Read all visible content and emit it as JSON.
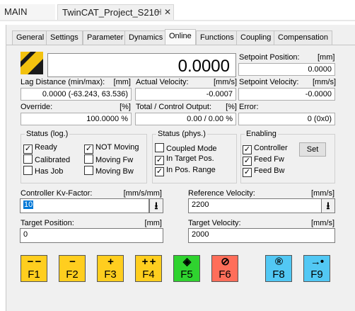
{
  "doc_tabs": {
    "main": "MAIN",
    "project": "TwinCAT_Project_S210",
    "pin": "⊣",
    "close": "✕"
  },
  "tabs": [
    "General",
    "Settings",
    "Parameter",
    "Dynamics",
    "Online",
    "Functions",
    "Coupling",
    "Compensation"
  ],
  "active_tab": "Online",
  "position": {
    "value": "0.0000"
  },
  "setpoint_position": {
    "label": "Setpoint Position:",
    "unit": "[mm]",
    "value": "0.0000"
  },
  "lag_distance": {
    "label": "Lag Distance (min/max):",
    "unit": "[mm]",
    "value": "0.0000  (-63.243, 63.536)"
  },
  "actual_velocity": {
    "label": "Actual Velocity:",
    "unit": "[mm/s]",
    "value": "-0.0007"
  },
  "setpoint_velocity": {
    "label": "Setpoint Velocity:",
    "unit": "[mm/s]",
    "value": "-0.0000"
  },
  "override": {
    "label": "Override:",
    "unit": "[%]",
    "value": "100.0000 %"
  },
  "control_output": {
    "label": "Total / Control Output:",
    "unit": "[%]",
    "value": "0.00 /  0.00 %"
  },
  "error": {
    "label": "Error:",
    "value": "0 (0x0)"
  },
  "status_log": {
    "title": "Status (log.)",
    "items": [
      {
        "label": "Ready",
        "checked": true
      },
      {
        "label": "Calibrated",
        "checked": false
      },
      {
        "label": "Has Job",
        "checked": false
      },
      {
        "label": "NOT Moving",
        "checked": true
      },
      {
        "label": "Moving Fw",
        "checked": false
      },
      {
        "label": "Moving Bw",
        "checked": false
      }
    ]
  },
  "status_phys": {
    "title": "Status (phys.)",
    "items": [
      {
        "label": "Coupled Mode",
        "checked": false
      },
      {
        "label": "In Target Pos.",
        "checked": true
      },
      {
        "label": "In Pos. Range",
        "checked": true
      }
    ]
  },
  "enabling": {
    "title": "Enabling",
    "items": [
      {
        "label": "Controller",
        "checked": true
      },
      {
        "label": "Feed Fw",
        "checked": true
      },
      {
        "label": "Feed Bw",
        "checked": true
      }
    ],
    "set_label": "Set"
  },
  "kv_factor": {
    "label": "Controller Kv-Factor:",
    "unit": "[mm/s/mm]",
    "value": "10"
  },
  "reference_velocity": {
    "label": "Reference Velocity:",
    "unit": "[mm/s]",
    "value": "2200"
  },
  "target_position": {
    "label": "Target Position:",
    "unit": "[mm]",
    "value": "0"
  },
  "target_velocity": {
    "label": "Target Velocity:",
    "unit": "[mm/s]",
    "value": "2000"
  },
  "spin_symbol": "⭳",
  "fkeys": [
    {
      "key": "F1",
      "symbol": "− −",
      "color": "#ffce1f"
    },
    {
      "key": "F2",
      "symbol": "−",
      "color": "#ffce1f"
    },
    {
      "key": "F3",
      "symbol": "+",
      "color": "#ffce1f"
    },
    {
      "key": "F4",
      "symbol": "+ +",
      "color": "#ffce1f"
    },
    {
      "key": "F5",
      "symbol": "◈",
      "color": "#2fd32f"
    },
    {
      "key": "F6",
      "symbol": "⊘",
      "color": "#ff6e5a"
    },
    {
      "key": "F8",
      "symbol": "®",
      "color": "#52c8f4"
    },
    {
      "key": "F9",
      "symbol": "→•",
      "color": "#52c8f4"
    }
  ],
  "colors": {
    "accent_selection": "#0078d7",
    "jog_yellow": "#ffce1f",
    "start_green": "#2fd32f",
    "stop_red": "#ff6e5a",
    "reset_blue": "#52c8f4"
  }
}
